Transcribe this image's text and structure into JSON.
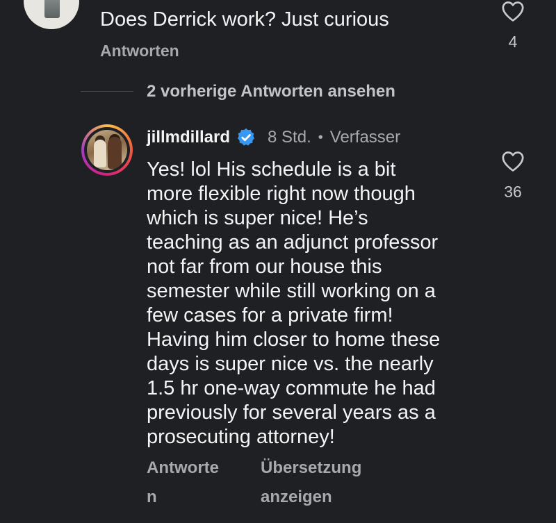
{
  "top_comment": {
    "text": "Does Derrick work? Just curious",
    "reply_label": "Antworten",
    "like_count": "4"
  },
  "view_previous": {
    "label": "2 vorherige Antworten ansehen"
  },
  "reply": {
    "username": "jillmdillard",
    "time": "8 Std.",
    "separator": "•",
    "author_badge": "Verfasser",
    "like_count": "36",
    "lines": [
      "Yes! lol His schedule is a bit",
      "more flexible right now though",
      "which is super nice! He’s",
      "teaching as an adjunct professor",
      "not far from our house this",
      "semester while still working on a",
      "few cases for a private firm!",
      "Having him closer to home these",
      "days is super nice vs. the nearly",
      "1.5 hr one-way commute he had",
      "previously for several years as a",
      "prosecuting attorney!"
    ],
    "reply_label_line1": "Antworte",
    "reply_label_line2": "n",
    "translate_line1": "Übersetzung",
    "translate_line2": "anzeigen"
  },
  "colors": {
    "background": "#1f2024",
    "text": "#f4f4f4",
    "muted": "#a8a8ad",
    "verified": "#3897f0"
  }
}
